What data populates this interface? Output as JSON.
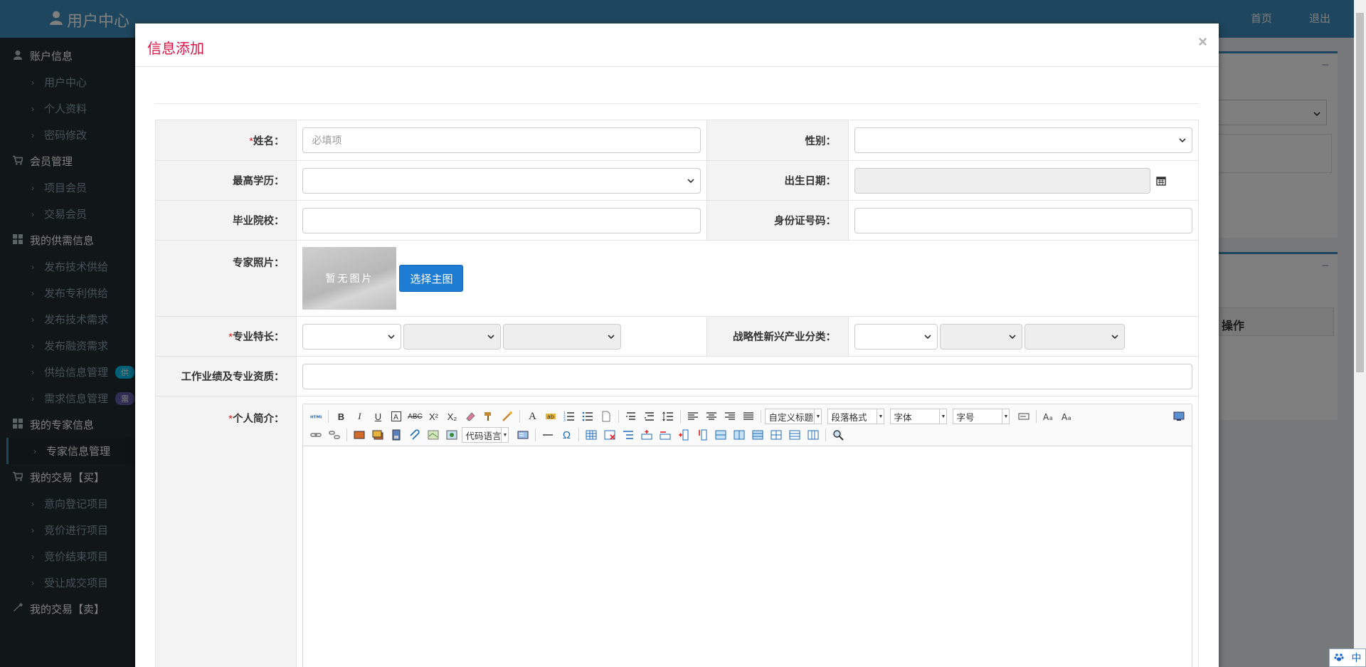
{
  "app": {
    "brand": "用户中心",
    "topnav": [
      "首页",
      "退出"
    ]
  },
  "sidebar": {
    "groups": [
      {
        "label": "账户信息",
        "icon": "user-icon",
        "items": [
          "用户中心",
          "个人资料",
          "密码修改"
        ]
      },
      {
        "label": "会员管理",
        "icon": "cart-icon",
        "items": [
          "项目会员",
          "交易会员"
        ]
      },
      {
        "label": "我的供需信息",
        "icon": "windows-icon",
        "items": [
          "发布技术供给",
          "发布专利供给",
          "发布技术需求",
          "发布融资需求",
          "供给信息管理",
          "需求信息管理"
        ]
      },
      {
        "label": "我的专家信息",
        "icon": "windows-icon",
        "items": [
          "专家信息管理"
        ]
      },
      {
        "label": "我的交易【买】",
        "icon": "cart-icon",
        "items": [
          "意向登记项目",
          "竞价进行项目",
          "竞价结束项目",
          "受让成交项目"
        ]
      },
      {
        "label": "我的交易【卖】",
        "icon": "wrench-icon",
        "items": []
      }
    ],
    "badges": {
      "supply": "供",
      "demand": "需"
    }
  },
  "background": {
    "table_header": "操作"
  },
  "modal": {
    "title": "信息添加",
    "close": "×",
    "form": {
      "name_label": "姓名：",
      "name_placeholder": "必填项",
      "gender_label": "性别：",
      "education_label": "最高学历：",
      "birth_label": "出生日期：",
      "school_label": "毕业院校：",
      "idcard_label": "身份证号码：",
      "photo_label": "专家照片：",
      "photo_placeholder": "暂无图片",
      "photo_button": "选择主图",
      "specialty_label": "专业特长：",
      "industry_label": "战略性新兴产业分类：",
      "achievements_label": "工作业绩及专业资质：",
      "intro_label": "个人简介：",
      "required_mark": "*"
    },
    "editor": {
      "combos": {
        "custom_title": "自定义标题",
        "paragraph": "段落格式",
        "font": "字体",
        "font_size": "字号",
        "code_lang": "代码语言"
      }
    }
  },
  "ime": {
    "label": "中"
  }
}
